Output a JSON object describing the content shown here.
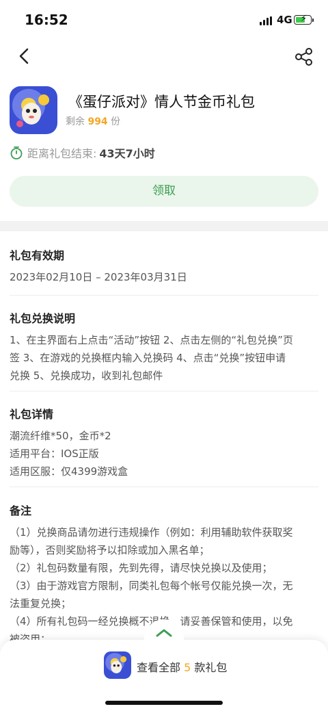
{
  "status": {
    "time": "16:52",
    "network": "4G"
  },
  "gift": {
    "title": "《蛋仔派对》情人节金币礼包",
    "remain_prefix": "剩余",
    "remain_count": "994",
    "remain_suffix": "份",
    "countdown_label": "距离礼包结束:",
    "countdown_value": "43天7小时",
    "claim_label": "领取"
  },
  "validity": {
    "heading": "礼包有效期",
    "text": "2023年02月10日 – 2023年03月31日"
  },
  "instructions": {
    "heading": "礼包兑换说明",
    "lines": [
      "1、在主界面右上点击“活动”按钮 2、点击左侧的“礼包兑换”页",
      "签 3、在游戏的兑换框内输入兑换码 4、点击“兑换”按钮申请",
      "兑换 5、兑换成功，收到礼包邮件"
    ]
  },
  "details": {
    "heading": "礼包详情",
    "lines": [
      "潮流纤维*50，金币*2",
      "适用平台：IOS正版",
      "适用区服：仅4399游戏盒"
    ]
  },
  "notes": {
    "heading": "备注",
    "lines": [
      "（1）兑换商品请勿进行违规操作（例如：利用辅助软件获取奖",
      "励等），否则奖励将予以扣除或加入黑名单；",
      "（2）礼包码数量有限，先到先得，请尽快兑换以及使用；",
      "（3）由于游戏官方限制，同类礼包每个帐号仅能兑换一次，无",
      "法重复兑换；",
      "（4）所有礼包码一经兑换概不退换，请妥善保管和使用，以免",
      "被盗用；"
    ]
  },
  "bottom": {
    "view_prefix": "查看全部",
    "view_count": "5",
    "view_suffix": "款礼包"
  },
  "colors": {
    "accent_green": "#3b9e52",
    "claim_bg": "#eaf5eb",
    "highlight_orange": "#f5a623"
  }
}
